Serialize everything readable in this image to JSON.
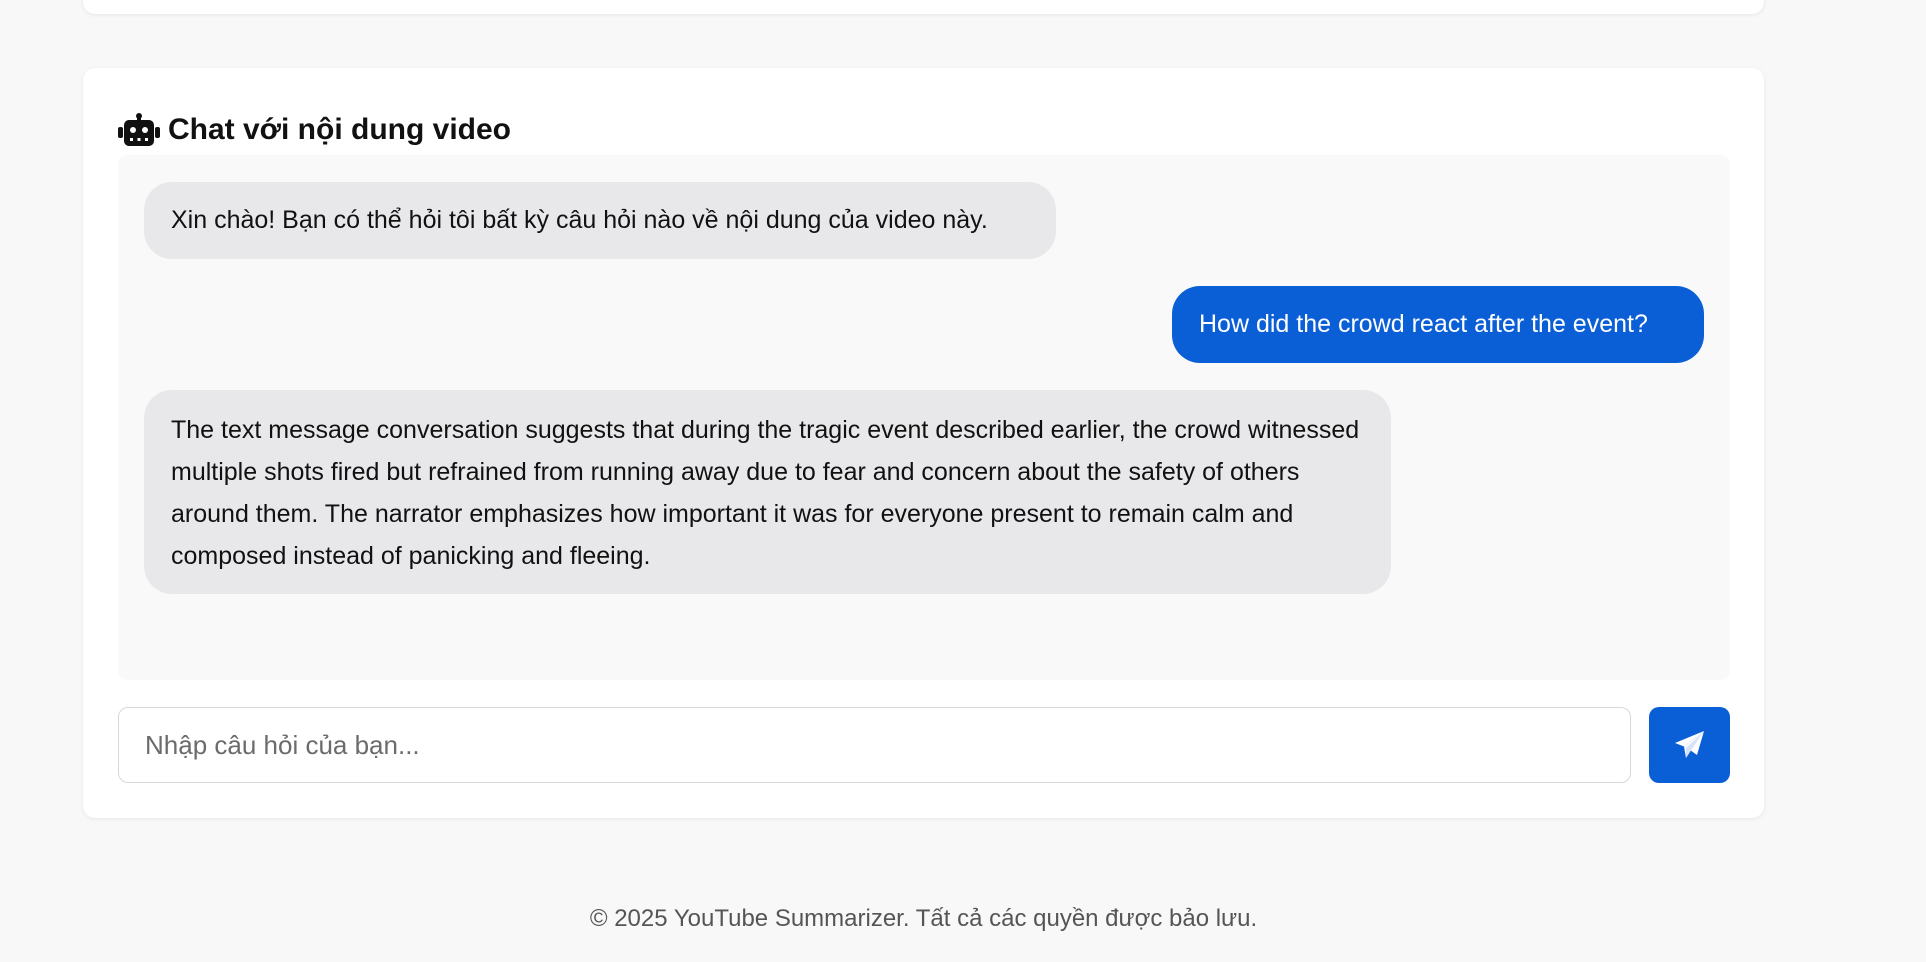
{
  "chat": {
    "heading": "Chat với nội dung video",
    "heading_icon": "robot-icon",
    "messages": [
      {
        "role": "bot",
        "text": "Xin chào! Bạn có thể hỏi tôi bất kỳ câu hỏi nào về nội dung của video này."
      },
      {
        "role": "user",
        "text": "How did the crowd react after the event?"
      },
      {
        "role": "bot",
        "text": "The text message conversation suggests that during the tragic event described earlier, the crowd witnessed multiple shots fired but refrained from running away due to fear and concern about the safety of others around them. The narrator emphasizes how important it was for everyone present to remain calm and composed instead of panicking and fleeing."
      }
    ],
    "input": {
      "placeholder": "Nhập câu hỏi của bạn...",
      "value": ""
    },
    "send_icon": "paper-plane-icon"
  },
  "footer": {
    "text": "© 2025 YouTube Summarizer. Tất cả các quyền được bảo lưu."
  },
  "colors": {
    "accent": "#0a5fd6",
    "bot_bubble": "#e8e8ea",
    "page_background": "#f8f8f8"
  }
}
